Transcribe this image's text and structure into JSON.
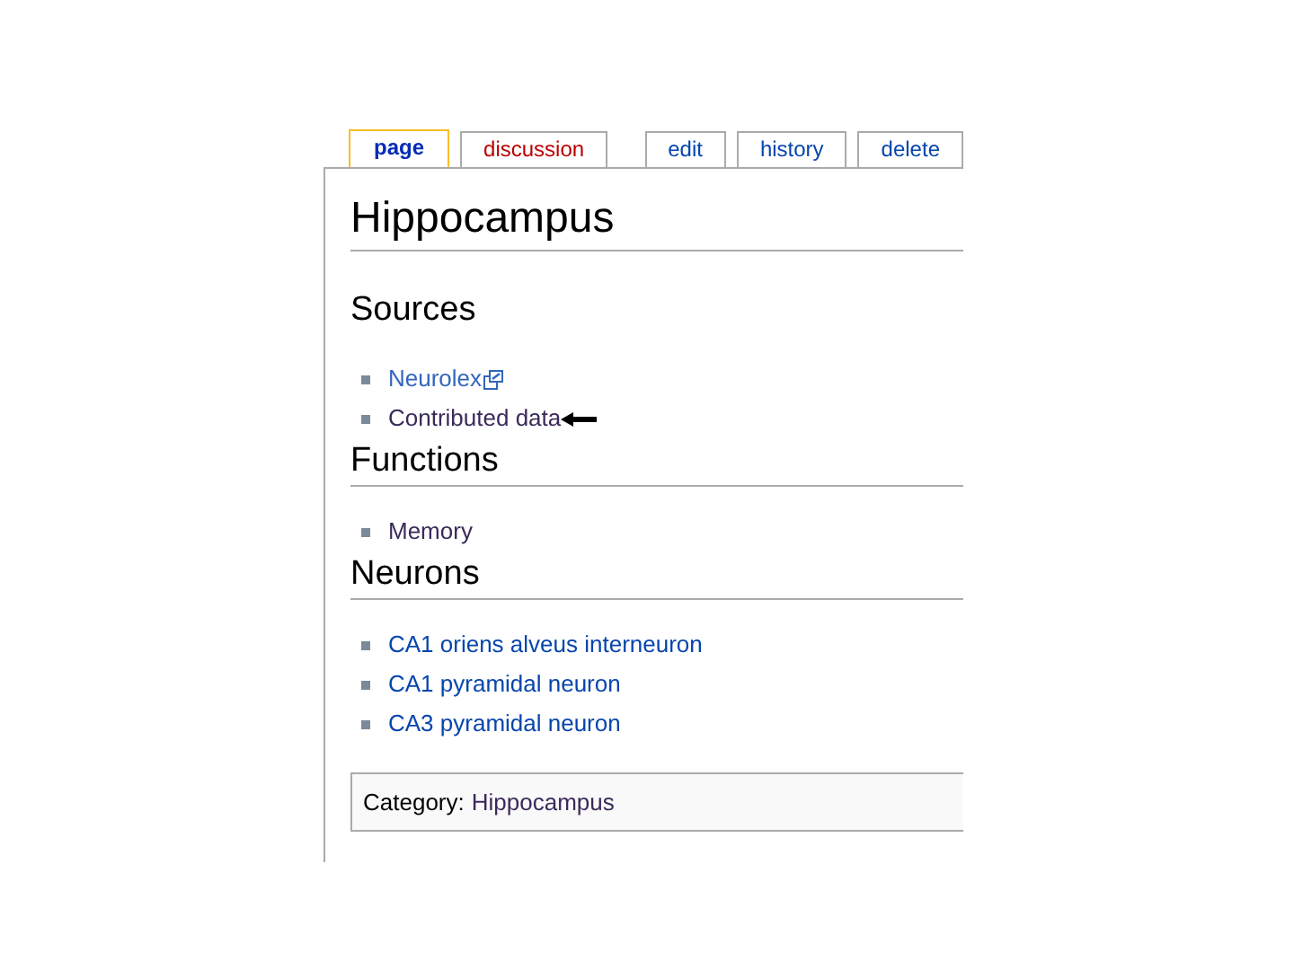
{
  "tabs": [
    {
      "label": "page",
      "selected": true,
      "exists": true
    },
    {
      "label": "discussion",
      "selected": false,
      "exists": false
    },
    {
      "label": "edit",
      "selected": false,
      "exists": true
    },
    {
      "label": "history",
      "selected": false,
      "exists": true
    },
    {
      "label": "delete",
      "selected": false,
      "exists": true
    }
  ],
  "title": "Hippocampus",
  "sections": [
    {
      "heading": "Sources",
      "items": [
        {
          "text": "Neurolex",
          "kind": "external",
          "arrow": false
        },
        {
          "text": "Contributed data",
          "kind": "visited",
          "arrow": true
        }
      ]
    },
    {
      "heading": "Functions",
      "items": [
        {
          "text": "Memory",
          "kind": "visited",
          "arrow": false
        }
      ]
    },
    {
      "heading": "Neurons",
      "items": [
        {
          "text": "CA1 oriens alveus interneuron",
          "kind": "link",
          "arrow": false
        },
        {
          "text": "CA1 pyramidal neuron",
          "kind": "link",
          "arrow": false
        },
        {
          "text": "CA3 pyramidal neuron",
          "kind": "link",
          "arrow": false
        }
      ]
    }
  ],
  "category": {
    "label": "Category:",
    "link": "Hippocampus"
  }
}
